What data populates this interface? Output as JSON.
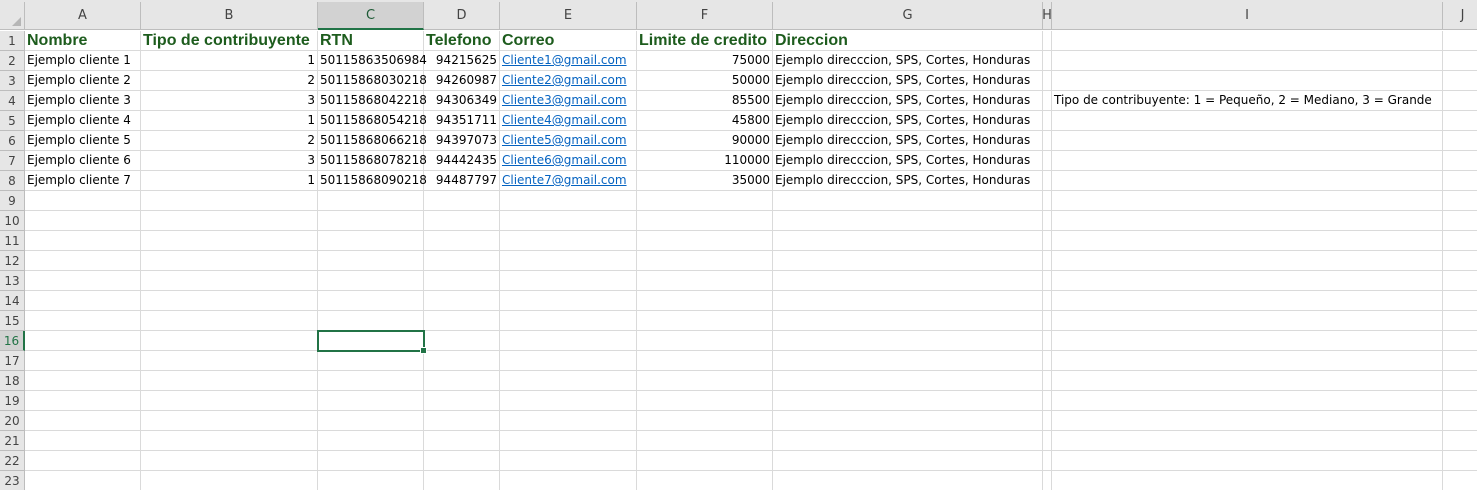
{
  "sheet": {
    "columns": [
      "A",
      "B",
      "C",
      "D",
      "E",
      "F",
      "G",
      "H",
      "I",
      "J"
    ],
    "selected_column": "C",
    "selected_row": 16,
    "row_numbers": [
      1,
      2,
      3,
      4,
      5,
      6,
      7,
      8,
      9,
      10,
      11,
      12,
      13,
      14,
      15,
      16,
      17,
      18,
      19,
      20,
      21,
      22,
      23
    ],
    "headers": [
      "Nombre",
      "Tipo de contribuyente",
      "RTN",
      "Telefono",
      "Correo",
      "Limite de credito",
      "Direccion"
    ],
    "rows": [
      {
        "nombre": "Ejemplo cliente 1",
        "tipo": "1",
        "rtn": "50115863506984",
        "telefono": "94215625",
        "correo": "Cliente1@gmail.com",
        "limite": "75000",
        "direccion": "Ejemplo direcccion, SPS, Cortes, Honduras"
      },
      {
        "nombre": "Ejemplo cliente 2",
        "tipo": "2",
        "rtn": "50115868030218",
        "telefono": "94260987",
        "correo": "Cliente2@gmail.com",
        "limite": "50000",
        "direccion": "Ejemplo direcccion, SPS, Cortes, Honduras"
      },
      {
        "nombre": "Ejemplo cliente 3",
        "tipo": "3",
        "rtn": "50115868042218",
        "telefono": "94306349",
        "correo": "Cliente3@gmail.com",
        "limite": "85500",
        "direccion": "Ejemplo direcccion, SPS, Cortes, Honduras"
      },
      {
        "nombre": "Ejemplo cliente 4",
        "tipo": "1",
        "rtn": "50115868054218",
        "telefono": "94351711",
        "correo": "Cliente4@gmail.com",
        "limite": "45800",
        "direccion": "Ejemplo direcccion, SPS, Cortes, Honduras"
      },
      {
        "nombre": "Ejemplo cliente 5",
        "tipo": "2",
        "rtn": "50115868066218",
        "telefono": "94397073",
        "correo": "Cliente5@gmail.com",
        "limite": "90000",
        "direccion": "Ejemplo direcccion, SPS, Cortes, Honduras"
      },
      {
        "nombre": "Ejemplo cliente 6",
        "tipo": "3",
        "rtn": "50115868078218",
        "telefono": "94442435",
        "correo": "Cliente6@gmail.com",
        "limite": "110000",
        "direccion": "Ejemplo direcccion, SPS, Cortes, Honduras"
      },
      {
        "nombre": "Ejemplo cliente 7",
        "tipo": "1",
        "rtn": "50115868090218",
        "telefono": "94487797",
        "correo": "Cliente7@gmail.com",
        "limite": "35000",
        "direccion": "Ejemplo direcccion, SPS, Cortes, Honduras"
      }
    ],
    "note": {
      "row": 4,
      "column": "I",
      "text": "Tipo de contribuyente:  1 = Pequeño, 2 = Mediano, 3 = Grande"
    },
    "colors": {
      "header_text": "#1d5c1d",
      "link": "#0563c1",
      "selection": "#217346"
    }
  }
}
